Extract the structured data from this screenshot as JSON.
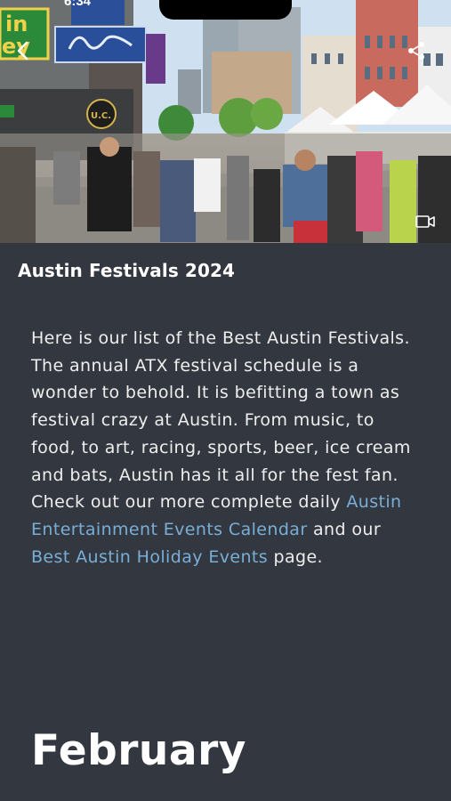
{
  "status_bar": {
    "time": "6:34"
  },
  "hero": {
    "image_alt": "Street festival crowd on a downtown Austin street",
    "signs": [
      "in",
      "ey",
      "U.C."
    ]
  },
  "header": {
    "title": "Austin Festivals 2024"
  },
  "intro": {
    "text_1": "Here is our list of the Best Austin Festivals. The annual ATX festival schedule is a wonder to behold. It is befitting a town as festival crazy at Austin. From music, to food, to art, racing, sports, beer, ice cream and bats, Austin has it all for the fest fan. Check out our more complete daily ",
    "link_1": "Austin Entertainment Events Calendar",
    "text_2": " and our ",
    "link_2": "Best Austin Holiday Events",
    "text_3": " page."
  },
  "section": {
    "heading": "February"
  },
  "colors": {
    "background": "#333840",
    "link": "#79aed6",
    "text": "#eeeeee"
  },
  "icons": [
    "chevron-left-icon",
    "share-icon",
    "video-icon"
  ]
}
